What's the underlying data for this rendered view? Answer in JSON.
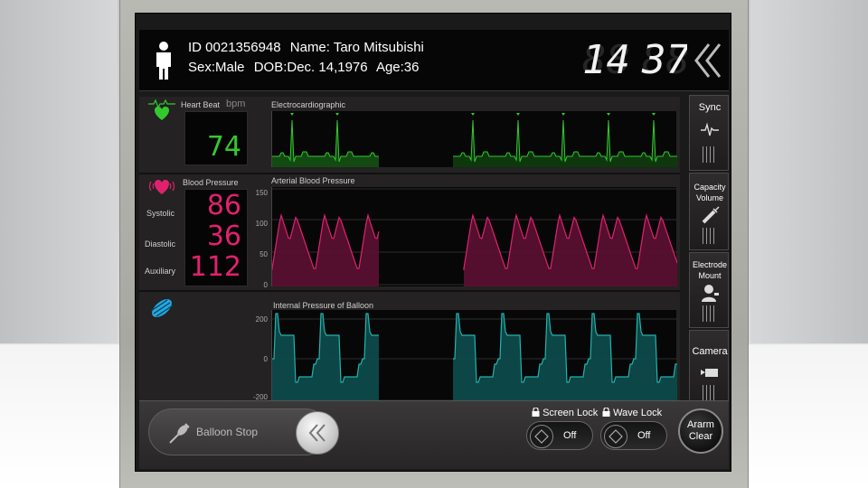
{
  "patient": {
    "id": "ID 0021356948",
    "name": "Name: Taro Mitsubishi",
    "sex": "Sex:Male",
    "dob": "DOB:Dec. 14,1976",
    "age": "Age:36"
  },
  "clock": {
    "hours": "14",
    "minutes": "37"
  },
  "heart": {
    "label": "Heart Beat",
    "unit": "bpm",
    "value": "74",
    "wave_title": "Electrocardiographic",
    "color": "#34c82f"
  },
  "bp": {
    "label": "Blood Pressure",
    "systolic_label": "Systolic",
    "diastolic_label": "Diastolic",
    "auxiliary_label": "Auxiliary",
    "systolic": "86",
    "diastolic": "36",
    "auxiliary": "112",
    "wave_title": "Arterial Blood Pressure",
    "axis": [
      "150",
      "100",
      "50",
      "0"
    ],
    "color": "#e0226e"
  },
  "balloon_pressure": {
    "wave_title": "Internal Pressure of Balloon",
    "axis": [
      "200",
      "0",
      "-200"
    ],
    "color": "#22b3b0"
  },
  "side": {
    "sync": "Sync",
    "capacity": [
      "Capacity",
      "Volume"
    ],
    "electrode": [
      "Electrode",
      "Mount"
    ],
    "camera": "Camera"
  },
  "bottom": {
    "balloon_stop": "Balloon Stop",
    "screen_lock": "Screen Lock",
    "wave_lock": "Wave Lock",
    "screen_lock_value": "Off",
    "wave_lock_value": "Off",
    "alarm": [
      "Ararm",
      "Clear"
    ]
  },
  "icons": {
    "patient": "person-icon",
    "heart": "heart-icon",
    "bp": "heart-pulse-icon",
    "balloon": "balloon-pump-icon",
    "back": "double-chevron-left-icon",
    "lock": "lock-icon"
  }
}
